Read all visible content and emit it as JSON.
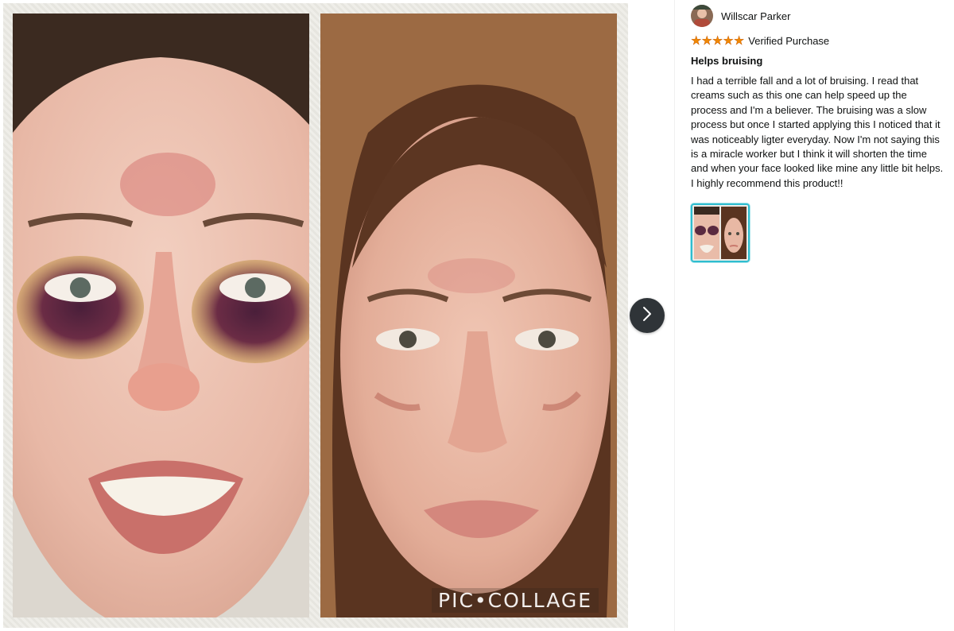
{
  "viewer": {
    "watermark": "PIC•COLLAGE",
    "next_icon": "chevron-right-icon"
  },
  "review": {
    "reviewer_name": "Willscar Parker",
    "rating": 5,
    "rating_max": 5,
    "star_color": "#f08804",
    "badge": "Verified Purchase",
    "title": "Helps bruising",
    "body": "I had a terrible fall and a lot of bruising. I read that creams such as this one can help speed up the process and I'm a believer. The bruising was a slow process but once I started applying this I noticed that it was noticeably ligter everyday. Now I'm not saying this is a miracle worker but I think it will shorten the time and when your face looked like mine any little bit helps. I highly recommend this product!!",
    "thumbnail_border_color": "#2ebdcf"
  },
  "colors": {
    "next_button_bg": "#2f3438",
    "text": "#0f1111"
  }
}
